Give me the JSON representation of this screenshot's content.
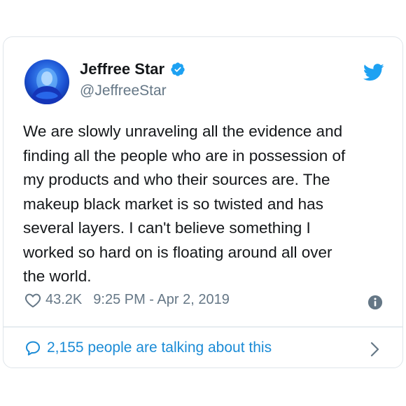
{
  "author": {
    "name": "Jeffree Star",
    "handle": "@JeffreeStar",
    "verified": true
  },
  "tweet": {
    "text": "We are slowly unraveling all the evidence and\nfinding all the people who are in possession of\nmy products and who their sources are. The\nmakeup black market is so twisted and has\nseveral layers. I can't believe something I\nworked so hard on is floating around all over\nthe world.",
    "likes": "43.2K",
    "timestamp": "9:25 PM - Apr 2, 2019"
  },
  "footer": {
    "talking_label": "2,155 people are talking about this"
  },
  "colors": {
    "twitter_blue": "#1da1f2",
    "link_blue": "#1b8bd6",
    "text": "#14171a",
    "muted": "#657786",
    "border": "#dfe5ea"
  },
  "icons": {
    "brand": "twitter-bird-icon",
    "verified": "verified-badge-icon",
    "like": "heart-icon",
    "info": "info-icon",
    "conversation": "speech-bubble-icon",
    "more": "chevron-right-icon"
  }
}
